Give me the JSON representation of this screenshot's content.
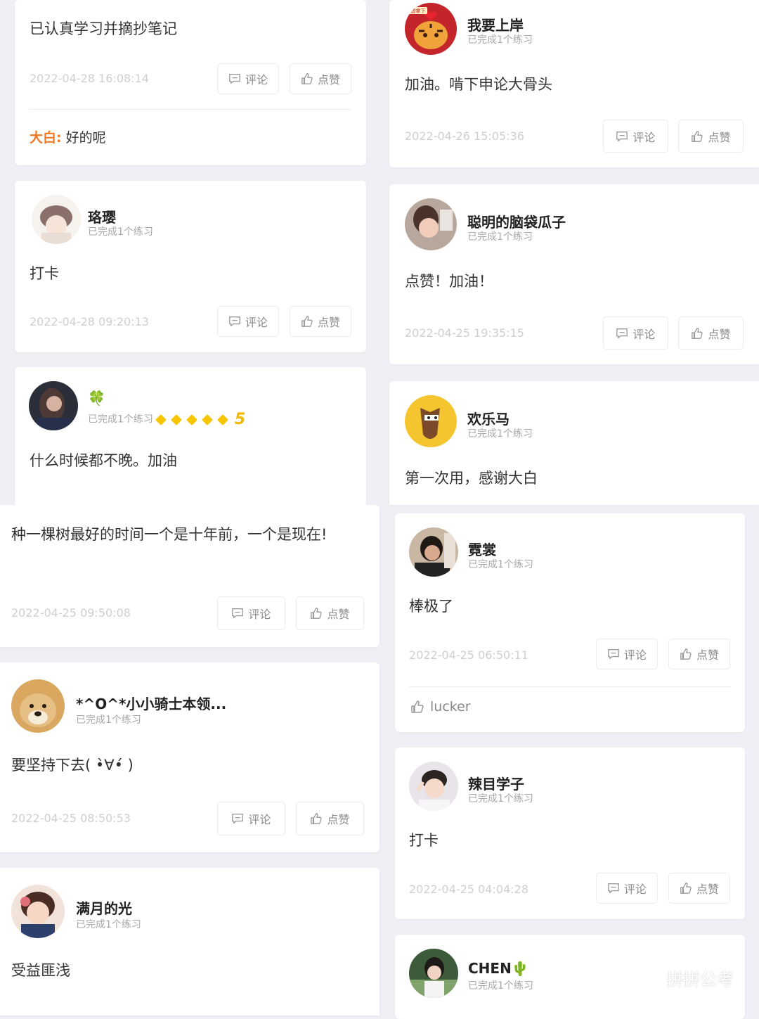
{
  "buttons": {
    "comment": "评论",
    "like": "点赞"
  },
  "left_column": [
    {
      "id": "c1",
      "content": "已认真学习并摘抄笔记",
      "time": "2022-04-28 16:08:14",
      "reply": {
        "name": "大白:",
        "text": "好的呢"
      }
    },
    {
      "id": "c2",
      "username": "珞璎",
      "subtitle": "已完成1个练习",
      "content": "打卡",
      "time": "2022-04-28 09:20:13"
    },
    {
      "id": "c3",
      "username": "🍀",
      "subtitle": "已完成1个练习",
      "level": "5",
      "content": "什么时候都不晚。加油"
    },
    {
      "id": "c4",
      "content": "种一棵树最好的时间一个是十年前，一个是现在!",
      "time": "2022-04-25 09:50:08"
    },
    {
      "id": "c5",
      "username": "*^O^*小小骑士本领...",
      "subtitle": "已完成1个练习",
      "content": "要坚持下去( •̀∀•́ )",
      "time": "2022-04-25 08:50:53"
    },
    {
      "id": "c6",
      "username": "满月的光",
      "subtitle": "已完成1个练习",
      "content": "受益匪浅"
    }
  ],
  "right_column": [
    {
      "id": "r1",
      "username": "我要上岸",
      "subtitle": "已完成1个练习",
      "avatar_badge": "想拿下",
      "content": "加油。啃下申论大骨头",
      "time": "2022-04-26 15:05:36"
    },
    {
      "id": "r2",
      "username": "聪明的脑袋瓜子",
      "subtitle": "已完成1个练习",
      "content": "点赞！加油！",
      "time": "2022-04-25 19:35:15"
    },
    {
      "id": "r3",
      "username": "欢乐马",
      "subtitle": "已完成1个练习",
      "content": "第一次用，感谢大白"
    },
    {
      "id": "r4",
      "username": "霓裳",
      "subtitle": "已完成1个练习",
      "content": "棒极了",
      "time": "2022-04-25 06:50:11",
      "likers": "lucker"
    },
    {
      "id": "r5",
      "username": "辣目学子",
      "subtitle": "已完成1个练习",
      "content": "打卡",
      "time": "2022-04-25 04:04:28"
    },
    {
      "id": "r6",
      "username": "CHEN🌵",
      "subtitle": "已完成1个练习"
    }
  ],
  "watermark": "拼拼公考",
  "colors": {
    "background": "#eef0f5",
    "reply_name": "#f07a23",
    "level_gem": "#f7c600"
  }
}
